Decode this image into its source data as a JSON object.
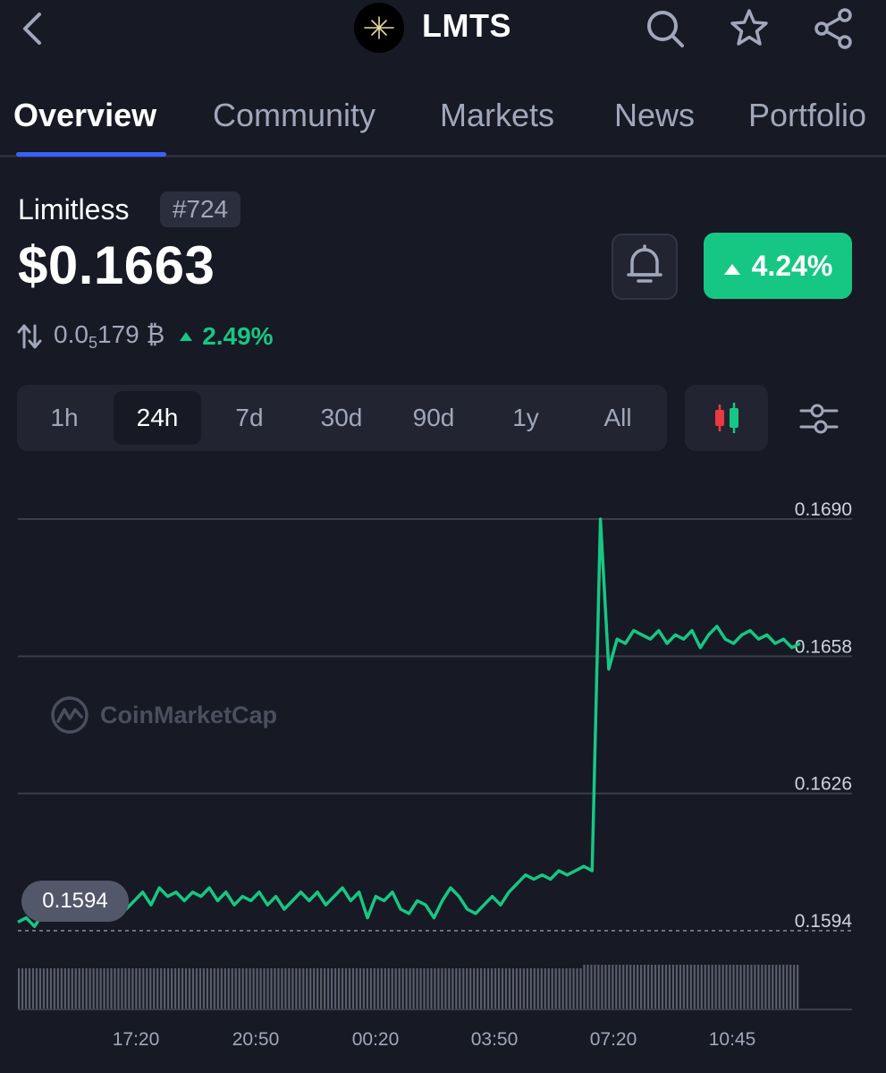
{
  "header": {
    "back_icon": "chevron-left-icon",
    "coin_symbol": "LMTS",
    "icons": [
      "search-icon",
      "star-icon",
      "share-icon"
    ]
  },
  "tabs": [
    {
      "label": "Overview",
      "active": true
    },
    {
      "label": "Community",
      "active": false
    },
    {
      "label": "Markets",
      "active": false
    },
    {
      "label": "News",
      "active": false
    },
    {
      "label": "Portfolio",
      "active": false
    }
  ],
  "coin": {
    "name": "Limitless",
    "rank": "#724",
    "price": "$0.1663",
    "change_24h": "4.24%",
    "btc_price_main": "0.0",
    "btc_price_sub": "5",
    "btc_price_rest": "179 ₿",
    "btc_change": "2.49%"
  },
  "timeframes": [
    {
      "label": "1h",
      "active": false
    },
    {
      "label": "24h",
      "active": true
    },
    {
      "label": "7d",
      "active": false
    },
    {
      "label": "30d",
      "active": false
    },
    {
      "label": "90d",
      "active": false
    },
    {
      "label": "1y",
      "active": false
    },
    {
      "label": "All",
      "active": false
    }
  ],
  "watermark": "CoinMarketCap",
  "colors": {
    "background": "#171924",
    "accent_green": "#16c784",
    "tab_underline": "#3861fb",
    "candle_red": "#ea3943"
  },
  "chart_data": {
    "type": "line",
    "y_ticks": [
      "0.1690",
      "0.1658",
      "0.1626",
      "0.1594"
    ],
    "x_ticks": [
      "17:20",
      "20:50",
      "00:20",
      "03:50",
      "07:20",
      "10:45"
    ],
    "ylim": [
      0.1594,
      0.169
    ],
    "start_value_label": "0.1594",
    "series": [
      {
        "values": [
          0.1596,
          0.1597,
          0.1595,
          0.1598,
          0.1599,
          0.1597,
          0.16,
          0.1598,
          0.1601,
          0.1599,
          0.1603,
          0.16,
          0.1602,
          0.1599,
          0.1601,
          0.1603,
          0.16,
          0.1604,
          0.1602,
          0.1603,
          0.1601,
          0.1603,
          0.1602,
          0.1604,
          0.1601,
          0.1603,
          0.16,
          0.1602,
          0.1601,
          0.1603,
          0.16,
          0.1602,
          0.1599,
          0.1601,
          0.1603,
          0.1601,
          0.1603,
          0.16,
          0.1602,
          0.1604,
          0.1601,
          0.1603,
          0.1597,
          0.1602,
          0.1601,
          0.1603,
          0.1599,
          0.1598,
          0.1601,
          0.16,
          0.1597,
          0.1601,
          0.1604,
          0.1602,
          0.1599,
          0.1598,
          0.16,
          0.1602,
          0.16,
          0.1603,
          0.1605,
          0.1607,
          0.1606,
          0.1607,
          0.1606,
          0.1608,
          0.1607,
          0.1608,
          0.1609,
          0.1608,
          0.169,
          0.1655,
          0.1662,
          0.1661,
          0.1664,
          0.1663,
          0.1662,
          0.1664,
          0.1661,
          0.1663,
          0.1662,
          0.1664,
          0.166,
          0.1663,
          0.1665,
          0.1662,
          0.1661,
          0.1663,
          0.1664,
          0.1662,
          0.1663,
          0.1661,
          0.1662,
          0.166,
          0.1661
        ]
      }
    ]
  }
}
